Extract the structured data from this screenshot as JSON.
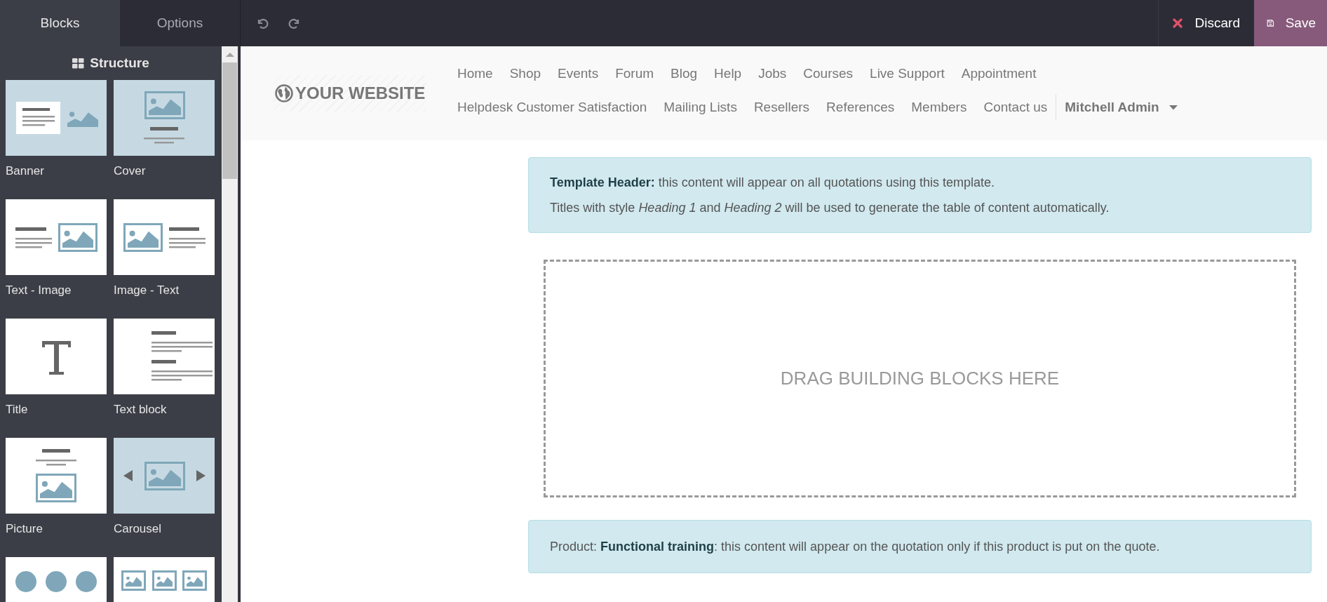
{
  "editor_tabs": [
    {
      "label": "Blocks",
      "selected": true
    },
    {
      "label": "Options",
      "selected": false
    }
  ],
  "toolbar": {
    "discard": "Discard",
    "save": "Save"
  },
  "panel": {
    "section_title": "Structure",
    "snippets": [
      {
        "kind": "banner",
        "label": "Banner"
      },
      {
        "kind": "cover",
        "label": "Cover"
      },
      {
        "kind": "text-image",
        "label": "Text - Image"
      },
      {
        "kind": "image-text",
        "label": "Image - Text"
      },
      {
        "kind": "title",
        "label": "Title"
      },
      {
        "kind": "text-block",
        "label": "Text block"
      },
      {
        "kind": "picture",
        "label": "Picture"
      },
      {
        "kind": "carousel",
        "label": "Carousel"
      },
      {
        "kind": "features"
      },
      {
        "kind": "gallery"
      }
    ]
  },
  "website": {
    "logo": "YOUR WEBSITE",
    "menu_rows": [
      [
        "Home",
        "Shop",
        "Events",
        "Forum",
        "Blog",
        "Help",
        "Jobs",
        "Courses",
        "Live Support",
        "Appointment"
      ],
      [
        "Helpdesk Customer Satisfaction",
        "Mailing Lists",
        "Resellers",
        "References",
        "Members",
        "Contact us"
      ]
    ],
    "user_menu": "Mitchell Admin"
  },
  "content": {
    "header_note": {
      "lines": [
        "**Template Header:** this content will appear on all quotations using this template.",
        "Titles with style *Heading 1* and *Heading 2* will be used to generate the table of content automatically."
      ]
    },
    "dropzone": "DRAG BUILDING BLOCKS HERE",
    "product_note": "Product: **Functional training**: this content will appear on the quotation only if this product is put on the quote."
  }
}
